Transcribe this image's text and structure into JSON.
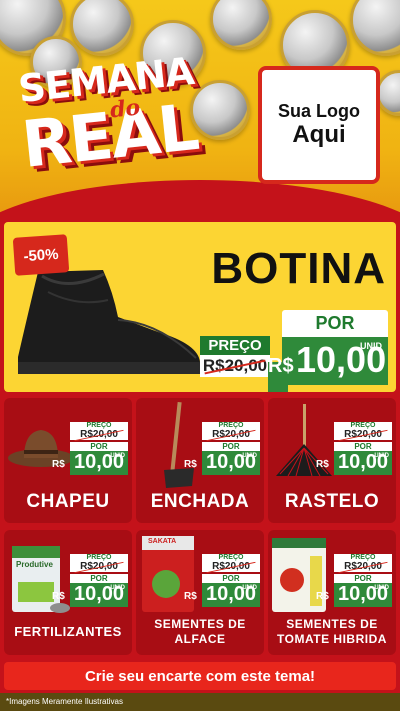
{
  "header": {
    "title_word1": "SEMANA",
    "title_word2": "do",
    "title_word3": "REAL",
    "logo_line1": "Sua Logo",
    "logo_line2": "Aqui"
  },
  "featured": {
    "discount_badge": "-50%",
    "name": "BOTINA",
    "preco_label": "PREÇO",
    "old_price": "R$20,00",
    "por_label": "POR",
    "currency": "R$",
    "new_price": "10,00",
    "unit": "UNID"
  },
  "products": [
    {
      "name": "CHAPEU",
      "preco_label": "PREÇO",
      "old_price": "R$20,00",
      "por_label": "POR",
      "currency": "R$",
      "new_price": "10,00",
      "unit": "UNID"
    },
    {
      "name": "ENCHADA",
      "preco_label": "PREÇO",
      "old_price": "R$20,00",
      "por_label": "POR",
      "currency": "R$",
      "new_price": "10,00",
      "unit": "UNID"
    },
    {
      "name": "RASTELO",
      "preco_label": "PREÇO",
      "old_price": "R$20,00",
      "por_label": "POR",
      "currency": "R$",
      "new_price": "10,00",
      "unit": "UNID"
    },
    {
      "name": "FERTILIZANTES",
      "preco_label": "PREÇO",
      "old_price": "R$20,00",
      "por_label": "POR",
      "currency": "R$",
      "new_price": "10,00",
      "unit": "UNID",
      "package_brand": "Produtive"
    },
    {
      "name": "SEMENTES DE ALFACE",
      "preco_label": "PREÇO",
      "old_price": "R$20,00",
      "por_label": "POR",
      "currency": "R$",
      "new_price": "10,00",
      "unit": "UNID",
      "package_brand": "SAKATA"
    },
    {
      "name": "SEMENTES DE TOMATE HIBRIDA",
      "preco_label": "PREÇO",
      "old_price": "R$20,00",
      "por_label": "POR",
      "currency": "R$",
      "new_price": "10,00",
      "unit": "UNID"
    }
  ],
  "cta": "Crie seu encarte com este tema!",
  "footer_note": "*Imagens Meramente Ilustrativas",
  "colors": {
    "red": "#c4121a",
    "dark_red": "#a80d14",
    "yellow": "#fcd533",
    "green": "#2f8a3a"
  }
}
